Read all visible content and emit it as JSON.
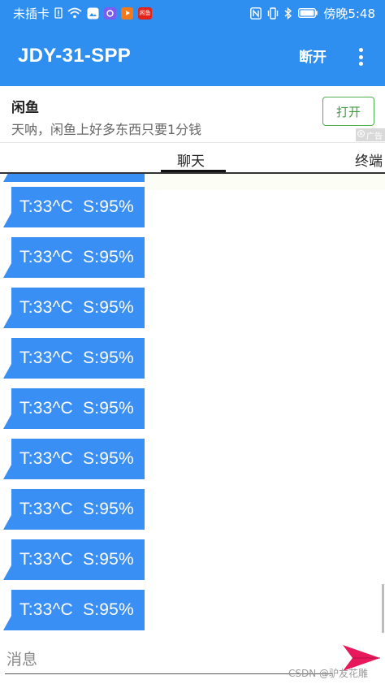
{
  "status_bar": {
    "carrier": "未插卡",
    "time": "傍晚5:48",
    "app_icon_label": "闲鱼"
  },
  "app_bar": {
    "title": "JDY-31-SPP",
    "disconnect_label": "断开"
  },
  "ad": {
    "title": "闲鱼",
    "text": "天呐，闲鱼上好多东西只要1分钱",
    "button_label": "打开",
    "tag": "广告"
  },
  "tabs": [
    {
      "label": "聊天",
      "active": true
    },
    {
      "label": "终端",
      "active": false
    }
  ],
  "messages": [
    "T:33^C  S:95%",
    "T:33^C  S:95%",
    "T:33^C  S:95%",
    "T:33^C  S:95%",
    "T:33^C  S:95%",
    "T:33^C  S:95%",
    "T:33^C  S:95%",
    "T:33^C  S:95%",
    "T:33^C  S:95%"
  ],
  "input": {
    "placeholder": "消息"
  },
  "watermark": "CSDN @驴友花雕",
  "colors": {
    "primary": "#2f8ff0",
    "bubble": "#3a8ff5",
    "send": "#e8195a",
    "open_button": "#4caf50"
  }
}
